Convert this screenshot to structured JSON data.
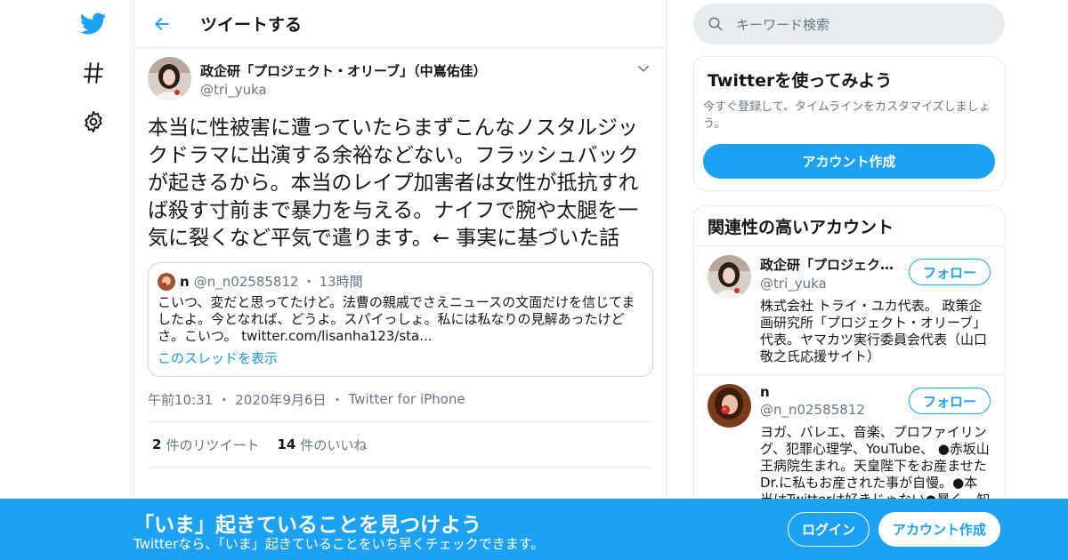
{
  "colors": {
    "brand": "#1da1f2",
    "text": "#14171a",
    "secondary": "#657786",
    "border": "#e6ecf0"
  },
  "nav": {
    "icons": [
      "twitter-bird-icon",
      "hashtag-icon",
      "gear-icon"
    ]
  },
  "header": {
    "title": "ツイートする"
  },
  "tweet": {
    "author_name": "政企研「プロジェクト・オリーブ」（中嶌佑佳）",
    "author_handle": "@tri_yuka",
    "text": "本当に性被害に遭っていたらまずこんなノスタルジックドラマに出演する余裕などない。フラッシュバックが起きるから。本当のレイプ加害者は女性が抵抗すれば殺す寸前まで暴力を与える。ナイフで腕や太腿を一気に裂くなど平気で遣ります。← 事実に基づいた話",
    "quote": {
      "name": "n",
      "handle": "@n_n02585812",
      "dot": "・",
      "time": "13時間",
      "text": "こいつ、変だと思ってたけど。法曹の親戚でさえニュースの文面だけを信じてましたよ。今となれば、どうよ。スパイっしょ。私には私なりの見解あったけどさ。こいつ。 twitter.com/lisanha123/sta...",
      "thread_link": "このスレッドを表示"
    },
    "meta": {
      "time": "午前10:31",
      "dot": "・",
      "date": "2020年9月6日",
      "source": "Twitter for iPhone"
    },
    "counts": {
      "retweets": "2",
      "retweets_label": "件のリツイート",
      "likes": "14",
      "likes_label": "件のいいね"
    }
  },
  "search": {
    "placeholder": "キーワード検索"
  },
  "try_card": {
    "title": "Twitterを使ってみよう",
    "desc": "今すぐ登録して、タイムラインをカスタマイズしましょう。",
    "button": "アカウント作成"
  },
  "related": {
    "title": "関連性の高いアカウント",
    "accounts": [
      {
        "name": "政企研「プロジェクト・オリーブ」（中嶌佑佳）",
        "handle": "@tri_yuka",
        "bio": "株式会社 トライ・ユカ代表。 政策企画研究所「プロジェクト・オリーブ」代表。ヤマカツ実行委員会代表（山口敬之氏応援サイト）",
        "follow": "フォロー"
      },
      {
        "name": "n",
        "handle": "@n_n02585812",
        "bio": "ヨガ、バレエ、音楽、プロファイリング、犯罪心理学、YouTube、 ●赤坂山王病院生まれ。天皇陛下をお産ませたDr.に私もお産された事が自慢。●本当はTwitterは好きじゃない●暴く。知る限",
        "follow": "フォロー"
      }
    ]
  },
  "bottom_bar": {
    "title": "「いま」起きていることを見つけよう",
    "subtitle": "Twitterなら、「いま」起きていることをいち早くチェックできます。",
    "login": "ログイン",
    "signup": "アカウント作成"
  }
}
